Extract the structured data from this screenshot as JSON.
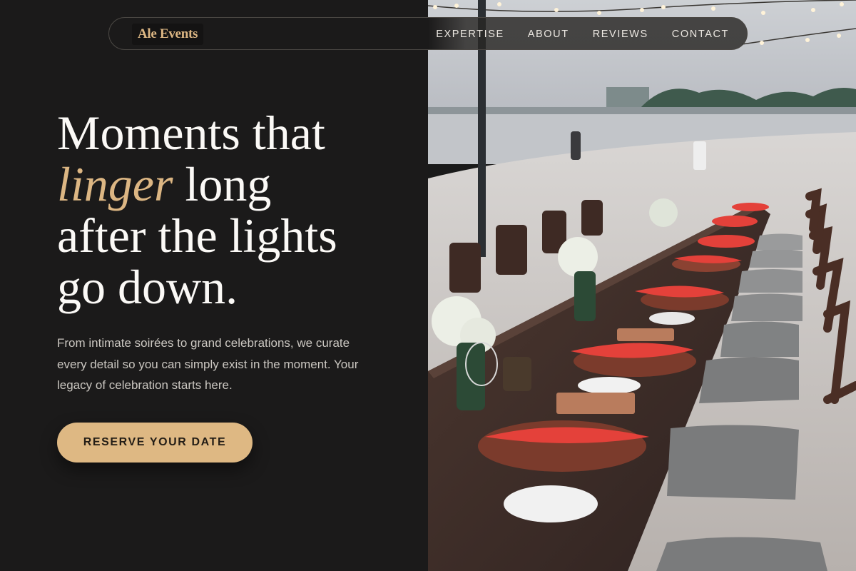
{
  "brand": {
    "name": "Ale Events",
    "accent_color": "#dcb683"
  },
  "nav": {
    "links": [
      {
        "label": "EXPERTISE"
      },
      {
        "label": "ABOUT"
      },
      {
        "label": "REVIEWS"
      },
      {
        "label": "CONTACT"
      }
    ]
  },
  "hero": {
    "headline_line1": "Moments that",
    "headline_accent": "linger",
    "headline_line2_rest": " long",
    "headline_line3": "after the lights",
    "headline_line4": "go down.",
    "subtext": "From intimate soirées to grand celebrations, we curate every detail so you can simply exist in the moment. Your legacy of celebration starts here.",
    "cta_label": "RESERVE YOUR DATE",
    "image_subject": "beach-dinner-table-photo"
  },
  "colors": {
    "background": "#1b1a1a",
    "button": "#deb883",
    "text": "#fbf9f6"
  }
}
